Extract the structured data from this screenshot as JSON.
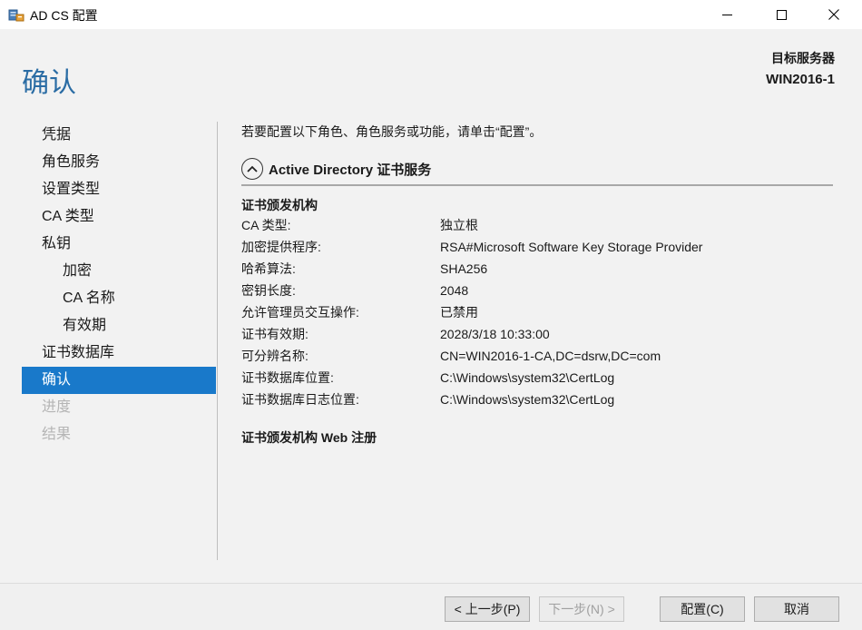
{
  "window": {
    "title": "AD CS 配置"
  },
  "header": {
    "page_title": "确认",
    "target_label": "目标服务器",
    "target_value": "WIN2016-1"
  },
  "nav": {
    "items": [
      {
        "label": "凭据",
        "state": "normal"
      },
      {
        "label": "角色服务",
        "state": "normal"
      },
      {
        "label": "设置类型",
        "state": "normal"
      },
      {
        "label": "CA 类型",
        "state": "normal"
      },
      {
        "label": "私钥",
        "state": "normal"
      },
      {
        "label": "加密",
        "state": "sub"
      },
      {
        "label": "CA 名称",
        "state": "sub"
      },
      {
        "label": "有效期",
        "state": "sub"
      },
      {
        "label": "证书数据库",
        "state": "normal"
      },
      {
        "label": "确认",
        "state": "active"
      },
      {
        "label": "进度",
        "state": "disabled"
      },
      {
        "label": "结果",
        "state": "disabled"
      }
    ]
  },
  "main": {
    "intro": "若要配置以下角色、角色服务或功能，请单击“配置”。",
    "section_title": "Active Directory 证书服务",
    "group1_title": "证书颁发机构",
    "properties": [
      {
        "key": "CA 类型:",
        "value": "独立根"
      },
      {
        "key": "加密提供程序:",
        "value": "RSA#Microsoft Software Key Storage Provider"
      },
      {
        "key": "哈希算法:",
        "value": "SHA256"
      },
      {
        "key": "密钥长度:",
        "value": "2048"
      },
      {
        "key": "允许管理员交互操作:",
        "value": "已禁用"
      },
      {
        "key": "证书有效期:",
        "value": "2028/3/18 10:33:00"
      },
      {
        "key": "可分辨名称:",
        "value": "CN=WIN2016-1-CA,DC=dsrw,DC=com"
      },
      {
        "key": "证书数据库位置:",
        "value": "C:\\Windows\\system32\\CertLog"
      },
      {
        "key": "证书数据库日志位置:",
        "value": "C:\\Windows\\system32\\CertLog"
      }
    ],
    "group2_title": "证书颁发机构 Web 注册"
  },
  "footer": {
    "prev_label": "< 上一步(P)",
    "next_label": "下一步(N) >",
    "configure_label": "配置(C)",
    "cancel_label": "取消"
  },
  "colors": {
    "accent": "#1979ca",
    "title": "#2a6ca4",
    "panel_bg": "#f2f2f2",
    "disabled_text": "#b5b5b5"
  },
  "icons": {
    "app": "server-icon",
    "collapse": "chevron-up-circle-icon",
    "minimize": "minimize-icon",
    "maximize": "maximize-icon",
    "close": "close-icon"
  }
}
